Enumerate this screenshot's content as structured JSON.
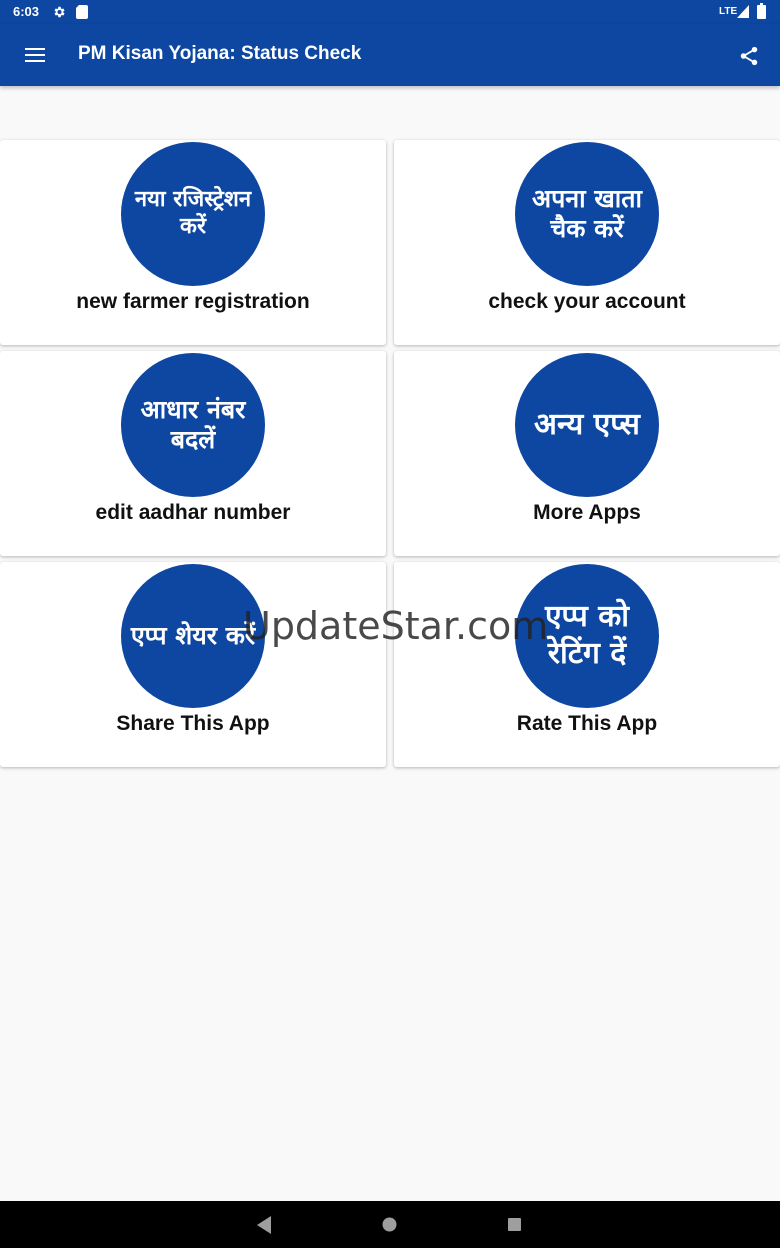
{
  "status_bar": {
    "time": "6:03",
    "network": "LTE",
    "icons": [
      "gear-icon",
      "sd-card-icon",
      "signal-icon",
      "battery-icon"
    ]
  },
  "app_bar": {
    "title": "PM Kisan Yojana: Status Check",
    "menu_icon": "hamburger-menu-icon",
    "share_icon": "share-icon"
  },
  "cards": [
    {
      "hindi": "नया रजिस्ट्रेशन करें",
      "label": "new farmer registration"
    },
    {
      "hindi": "अपना खाता चैक करें",
      "label": "check your account"
    },
    {
      "hindi": "आधार नंबर बदलें",
      "label": "edit aadhar number"
    },
    {
      "hindi": "अन्य एप्स",
      "label": "More Apps"
    },
    {
      "hindi": "एप्प शेयर करें",
      "label": "Share This App"
    },
    {
      "hindi": "एप्प को रेटिंग दें",
      "label": "Rate This App"
    }
  ],
  "watermark": "UpdateStar.com",
  "nav_bar": {
    "icons": [
      "back-icon",
      "home-icon",
      "recents-icon"
    ]
  },
  "colors": {
    "primary": "#0d47a1",
    "background": "#f9f9f9",
    "card": "#ffffff",
    "text": "#111111"
  }
}
